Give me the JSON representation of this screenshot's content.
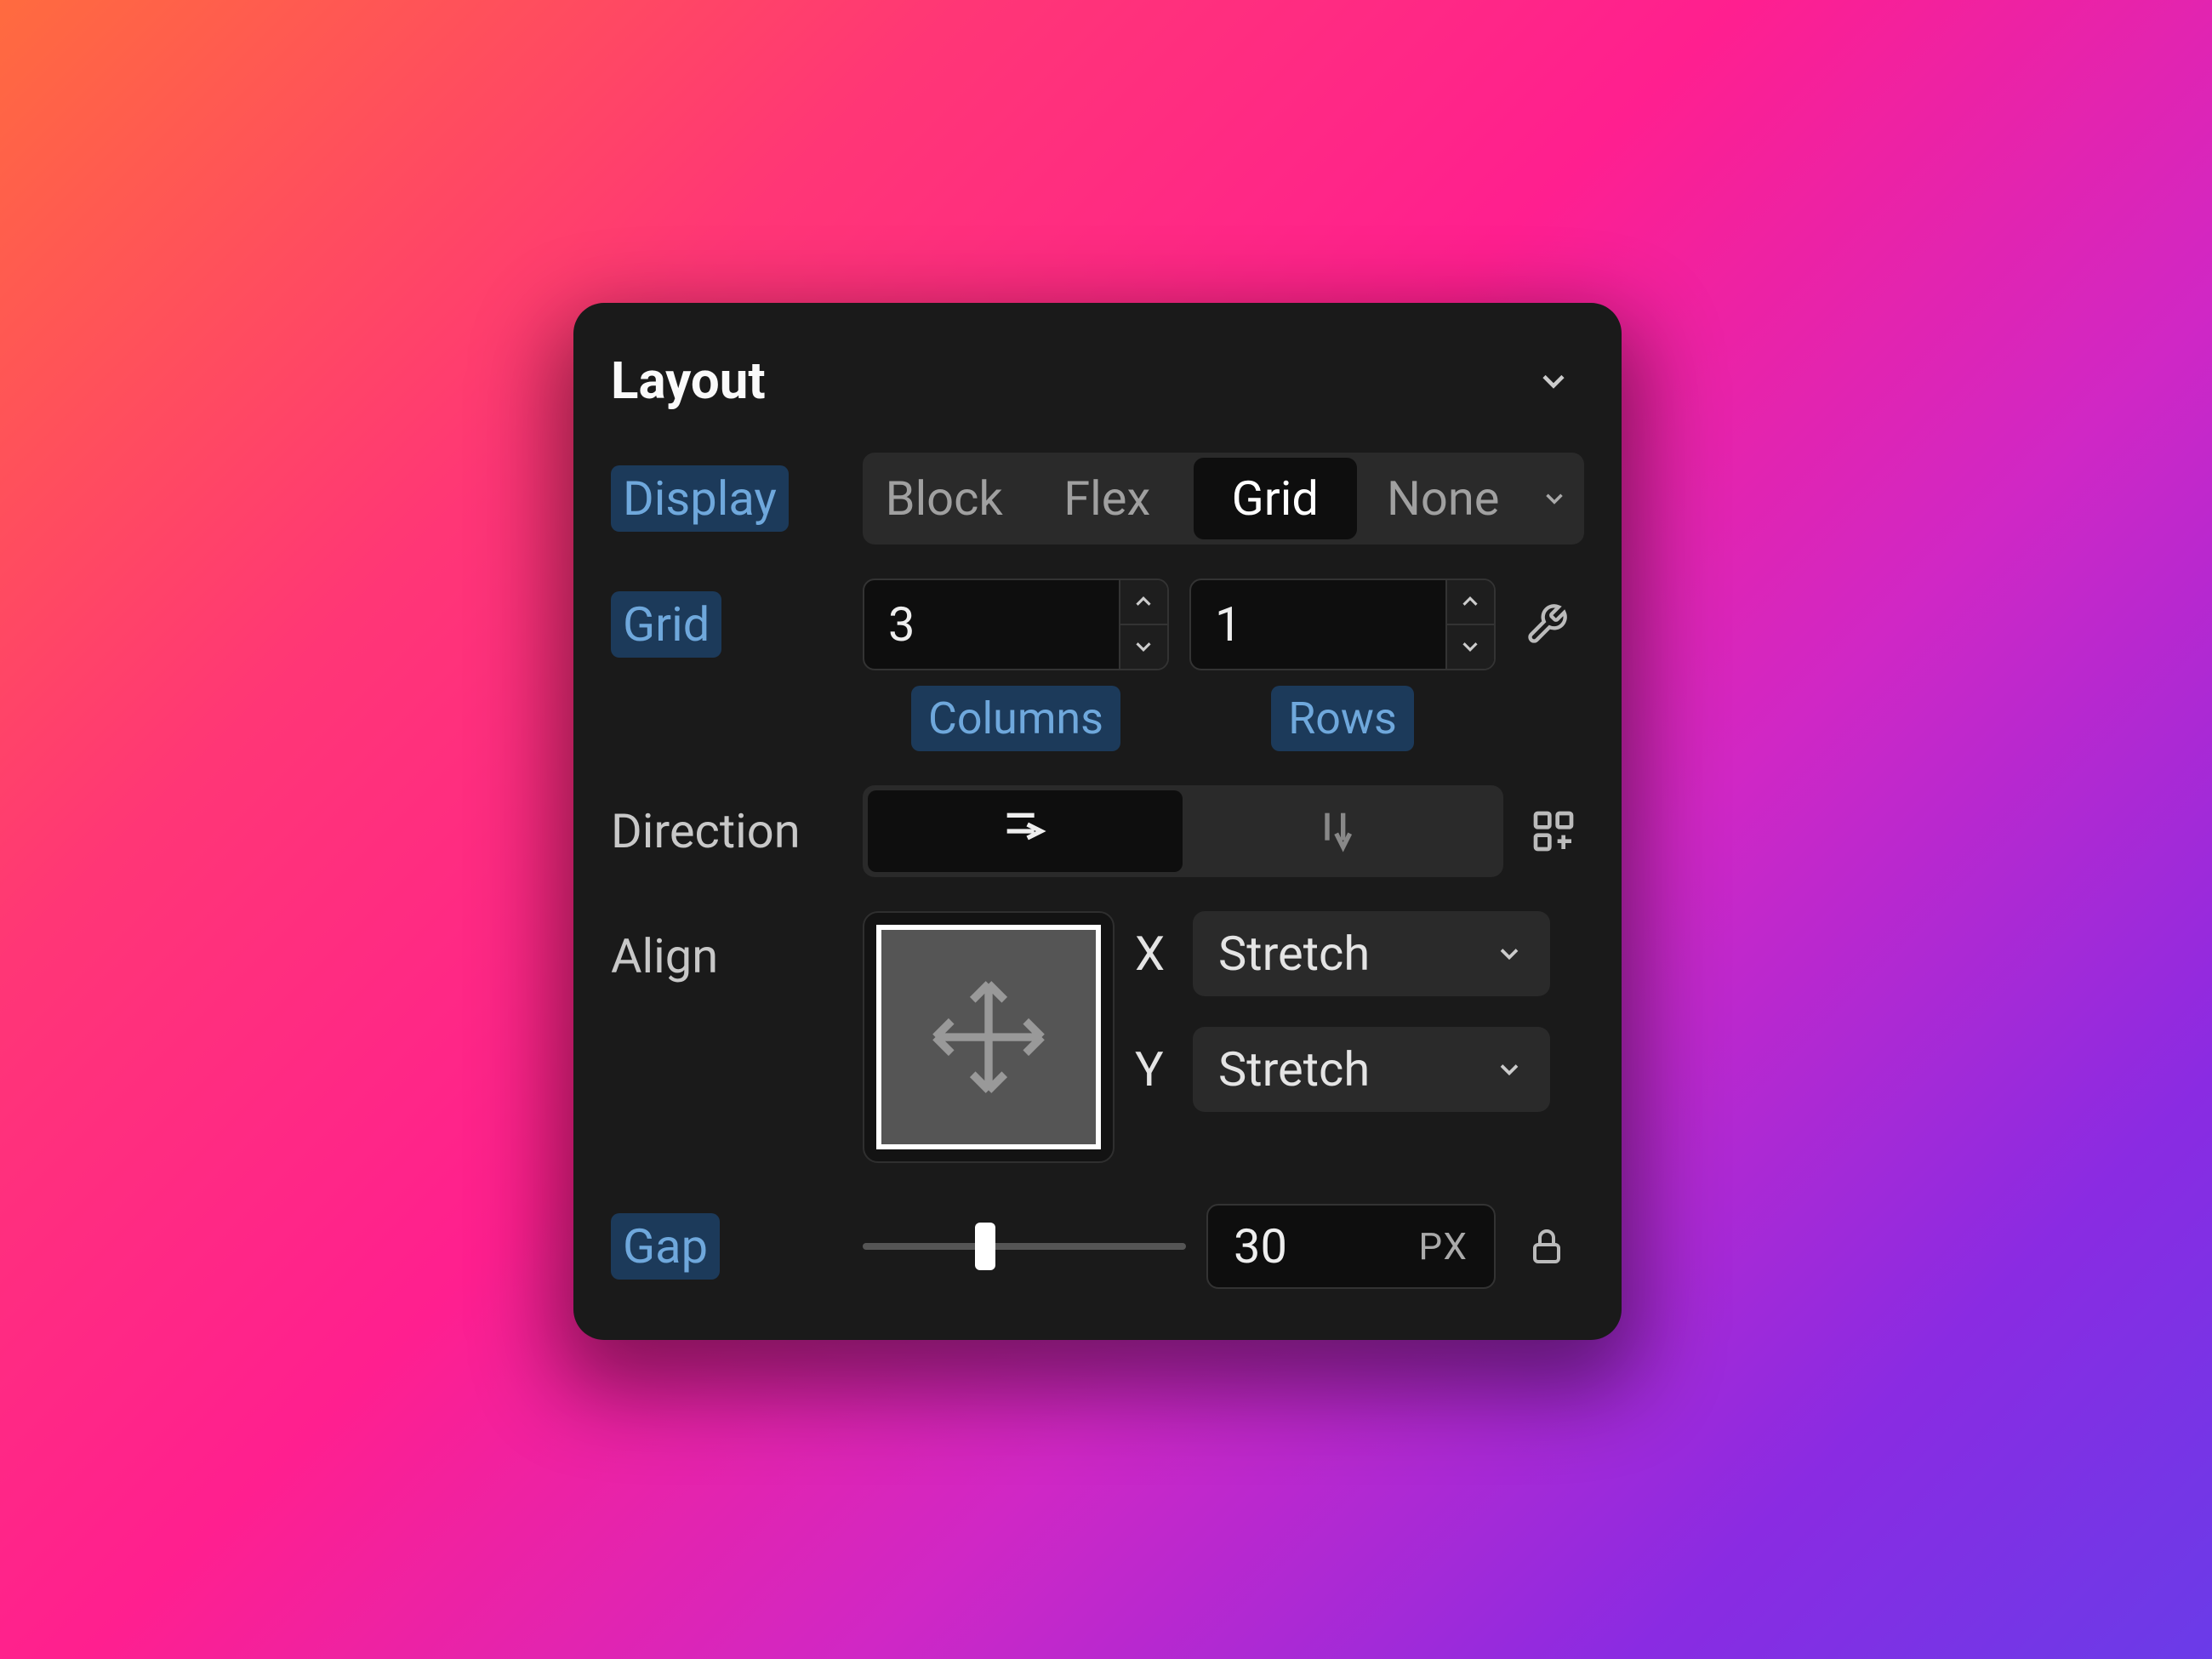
{
  "header": {
    "title": "Layout"
  },
  "display": {
    "label": "Display",
    "options": [
      "Block",
      "Flex",
      "Grid",
      "None"
    ],
    "selected": "Grid"
  },
  "grid": {
    "label": "Grid",
    "columns": "3",
    "rows": "1",
    "columns_label": "Columns",
    "rows_label": "Rows"
  },
  "direction": {
    "label": "Direction",
    "selected": "row"
  },
  "align": {
    "label": "Align",
    "x_label": "X",
    "y_label": "Y",
    "x_value": "Stretch",
    "y_value": "Stretch"
  },
  "gap": {
    "label": "Gap",
    "value": "30",
    "unit": "PX"
  }
}
